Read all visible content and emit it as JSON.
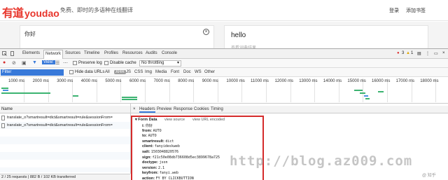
{
  "youdao": {
    "logo_cn": "有道",
    "logo_en": "youdao",
    "slogan": "免费、即时的多语种在线翻译",
    "login": "登录",
    "add_extension": "添加书签",
    "input_value": "你好",
    "output_value": "hello",
    "output_hint": "查看词典结果"
  },
  "devtools": {
    "tabs": [
      "Elements",
      "Network",
      "Sources",
      "Timeline",
      "Profiles",
      "Resources",
      "Audits",
      "Console"
    ],
    "active_tab": "Network",
    "error_count": "3",
    "warning_count": "1",
    "toolbar": {
      "view_label": "View:",
      "preserve_log": "Preserve log",
      "disable_cache": "Disable cache",
      "throttling": "No throttling"
    },
    "filter": {
      "placeholder": "Filter",
      "hide_data_urls": "Hide data URLs",
      "types": [
        "All",
        "XHR",
        "JS",
        "CSS",
        "Img",
        "Media",
        "Font",
        "Doc",
        "WS",
        "Other"
      ]
    },
    "timeline_ticks": [
      "1000 ms",
      "2000 ms",
      "3000 ms",
      "4000 ms",
      "5000 ms",
      "6000 ms",
      "7000 ms",
      "8000 ms",
      "9000 ms",
      "10000 ms",
      "11000 ms",
      "12000 ms",
      "13000 ms",
      "14000 ms",
      "15000 ms",
      "16000 ms",
      "17000 ms",
      "18000 ms"
    ],
    "requests": {
      "column_name": "Name",
      "rows": [
        "translate_o?smartresult=dict&smartresult=rule&sessionFrom=",
        "translate_o?smartresult=dict&smartresult=rule&sessionFrom="
      ]
    },
    "detail_tabs": [
      "Headers",
      "Preview",
      "Response",
      "Cookies",
      "Timing"
    ],
    "active_detail_tab": "Headers",
    "form_data": {
      "title": "Form Data",
      "view_source": "view source",
      "view_url_encoded": "view URL encoded",
      "rows": [
        {
          "k": "i:",
          "v": "你好"
        },
        {
          "k": "from:",
          "v": "AUTO"
        },
        {
          "k": "to:",
          "v": "AUTO"
        },
        {
          "k": "smartresult:",
          "v": "dict"
        },
        {
          "k": "client:",
          "v": "fanyideskweb"
        },
        {
          "k": "salt:",
          "v": "1503048820576"
        },
        {
          "k": "sign:",
          "v": "f21c50e08db736608d5ec3899678a725"
        },
        {
          "k": "doctype:",
          "v": "json"
        },
        {
          "k": "version:",
          "v": "2.1"
        },
        {
          "k": "keyfrom:",
          "v": "fanyi.web"
        },
        {
          "k": "action:",
          "v": "FY_BY_CLICKBUTTION"
        }
      ]
    },
    "status": "2 / 25 requests | 882 B / 102 KB transferred"
  },
  "watermark": {
    "url": "http://blog.az009.com",
    "corner": "@ 知乎"
  },
  "colors": {
    "brand_red": "#e8362c",
    "filter_blue": "#3879d9",
    "highlight_red": "#d52b2b"
  }
}
